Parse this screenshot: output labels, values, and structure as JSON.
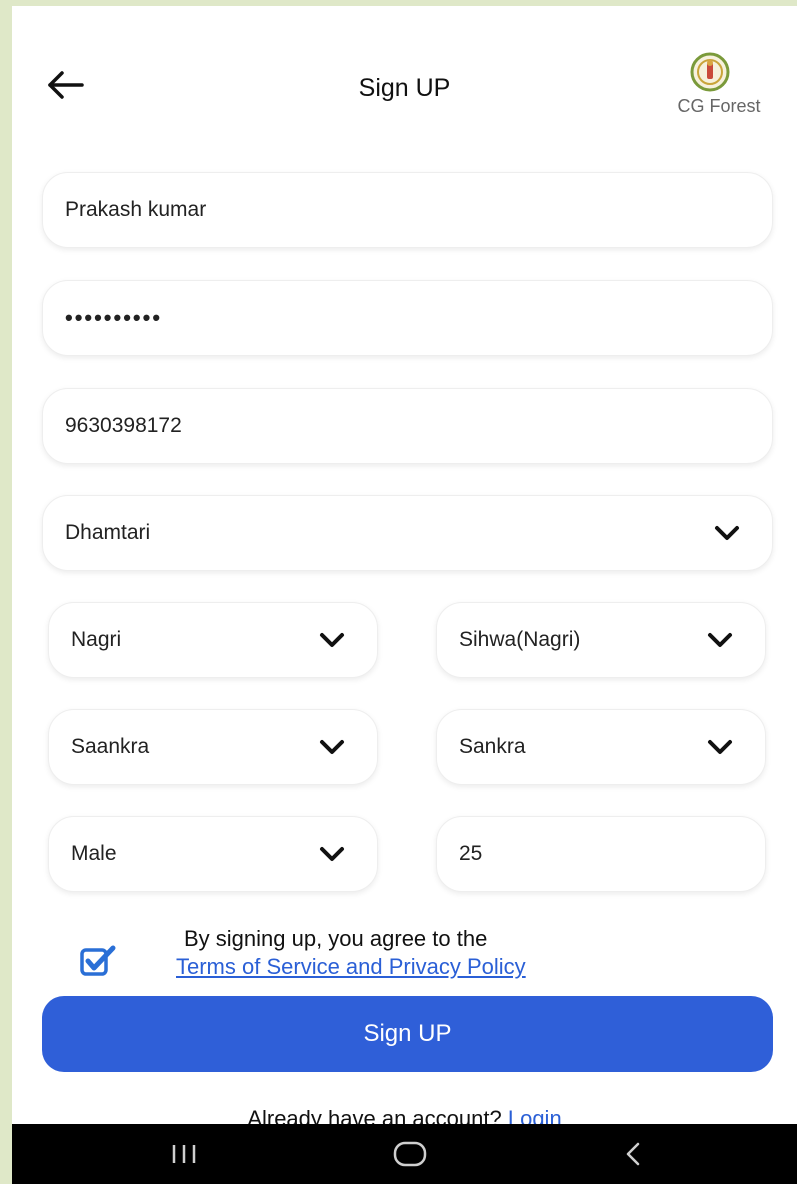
{
  "header": {
    "title": "Sign UP",
    "logo_text": "CG Forest"
  },
  "form": {
    "name": {
      "value": "Prakash kumar"
    },
    "password": {
      "value": "••••••••••"
    },
    "phone": {
      "value": "9630398172"
    },
    "district": {
      "value": "Dhamtari"
    },
    "block": {
      "value": "Nagri"
    },
    "range": {
      "value": "Sihwa(Nagri)"
    },
    "village": {
      "value": "Saankra"
    },
    "sub_village": {
      "value": "Sankra"
    },
    "gender": {
      "value": "Male"
    },
    "age": {
      "value": "25"
    }
  },
  "terms": {
    "checked": true,
    "line1": "By signing up, you agree to the",
    "link": "Terms of Service and Privacy Policy"
  },
  "signup_button": {
    "label": "Sign UP"
  },
  "login": {
    "prompt": "Already have an account?",
    "link": "Login"
  },
  "colors": {
    "accent": "#2f5fd8",
    "link": "#2a5fd6",
    "navbar": "#000000"
  },
  "icons": {
    "back": "arrow-left-icon",
    "dropdown": "chevron-down-icon",
    "checkbox": "checkbox-checked-icon",
    "nav_recents": "recents-icon",
    "nav_home": "home-icon",
    "nav_back": "nav-back-icon"
  }
}
